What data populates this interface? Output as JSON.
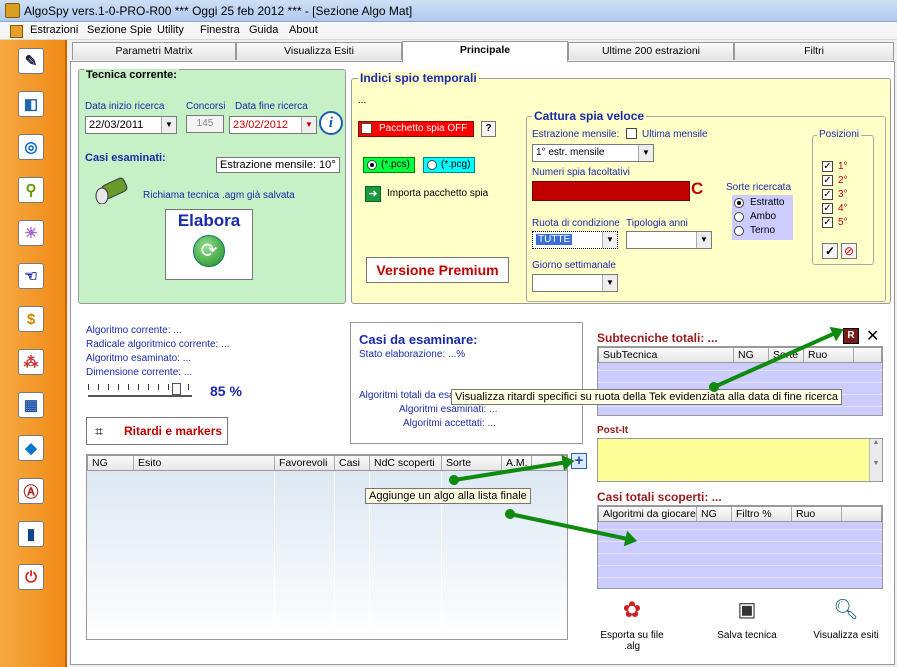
{
  "window": {
    "title": "AlgoSpy vers.1-0-PRO-R00  ***  Oggi 25 feb 2012  ***   - [Sezione Algo Mat]"
  },
  "menu": [
    "Estrazioni",
    "Sezione Spie",
    "Utility",
    "Finestra",
    "Guida",
    "About"
  ],
  "tabs": [
    "Parametri Matrix",
    "Visualizza Esiti",
    "Principale",
    "Ultime 200 estrazioni",
    "Filtri"
  ],
  "tecnica": {
    "title": "Tecnica corrente:",
    "data_inizio_label": "Data inizio ricerca",
    "data_inizio": "22/03/2011",
    "concorsi_label": "Concorsi",
    "concorsi": "145",
    "data_fine_label": "Data fine ricerca",
    "data_fine": "23/02/2012",
    "casi_label": "Casi esaminati:",
    "tooltip_estrazione": "Estrazione mensile: 10°",
    "richiama_label": "Richiama tecnica .agm già salvata",
    "elabora_label": "Elabora"
  },
  "indici": {
    "title": "Indici spio temporali",
    "dots": "...",
    "pacchetto_label": "Pacchetto spia OFF",
    "help": "?",
    "pcs_label": "(*.pcs)",
    "pcg_label": "(*.pcg)",
    "importa_label": "Importa pacchetto spia",
    "premium_label": "Versione Premium"
  },
  "cattura": {
    "title": "Cattura spia veloce",
    "estrazione_mensile_label": "Estrazione mensile:",
    "ultima_mensile_label": "Ultima mensile",
    "estr_value": "1° estr. mensile",
    "numeri_label": "Numeri spia facoltativi",
    "c_label": "C",
    "sorte_label": "Sorte ricercata",
    "sorte_options": [
      "Estratto",
      "Ambo",
      "Terno"
    ],
    "ruota_label": "Ruota di condizione",
    "ruota_value": "TUTTE",
    "tipologia_label": "Tipologia anni",
    "giorno_label": "Giorno settimanale",
    "posizioni_title": "Posizioni",
    "posizioni": [
      "1°",
      "2°",
      "3°",
      "4°",
      "5°"
    ]
  },
  "algo": {
    "corrente": "Algoritmo corrente:  ...",
    "radicale": "Radicale algoritmico corrente:   ...",
    "esaminato": "Algoritmo esaminato:   ...",
    "dimensione": "Dimensione corrente:   ...",
    "percent": "85 %",
    "ritardi_label": "Ritardi e markers"
  },
  "casi": {
    "title": "Casi da esaminare:",
    "stato": "Stato elaborazione:  ...%",
    "totali": "Algoritmi totali da esaminare:",
    "esaminati": "Algoritmi esaminati:   ...",
    "accettati": "Algoritmi accettati:   ..."
  },
  "grid_main": {
    "columns": [
      "NG",
      "Esito",
      "Favorevoli",
      "Casi",
      "NdC scoperti",
      "Sorte",
      "A.M."
    ]
  },
  "subtecniche": {
    "title": "Subtecniche totali:  ...",
    "columns": [
      "SubTecnica",
      "NG",
      "Sorte",
      "Ruo"
    ]
  },
  "postit": {
    "title": "Post-It"
  },
  "casi_totali": {
    "title": "Casi totali scoperti:  ...",
    "columns": [
      "Algoritmi da giocare",
      "NG",
      "Filtro %",
      "Ruo"
    ]
  },
  "tips": {
    "visualizza_ritardi": "Visualizza ritardi specifici su ruota della Tek evidenziata alla data di fine ricerca",
    "aggiunge_algo": "Aggiunge un algo alla lista finale"
  },
  "bottom_buttons": [
    "Esporta su file .alg",
    "Salva tecnica",
    "Visualizza esiti"
  ],
  "colors": {
    "green_panel": "#c6f0c6",
    "yellow_panel": "#ffffc8",
    "red_field": "#c00000",
    "accent_orange": "#f08a18"
  }
}
